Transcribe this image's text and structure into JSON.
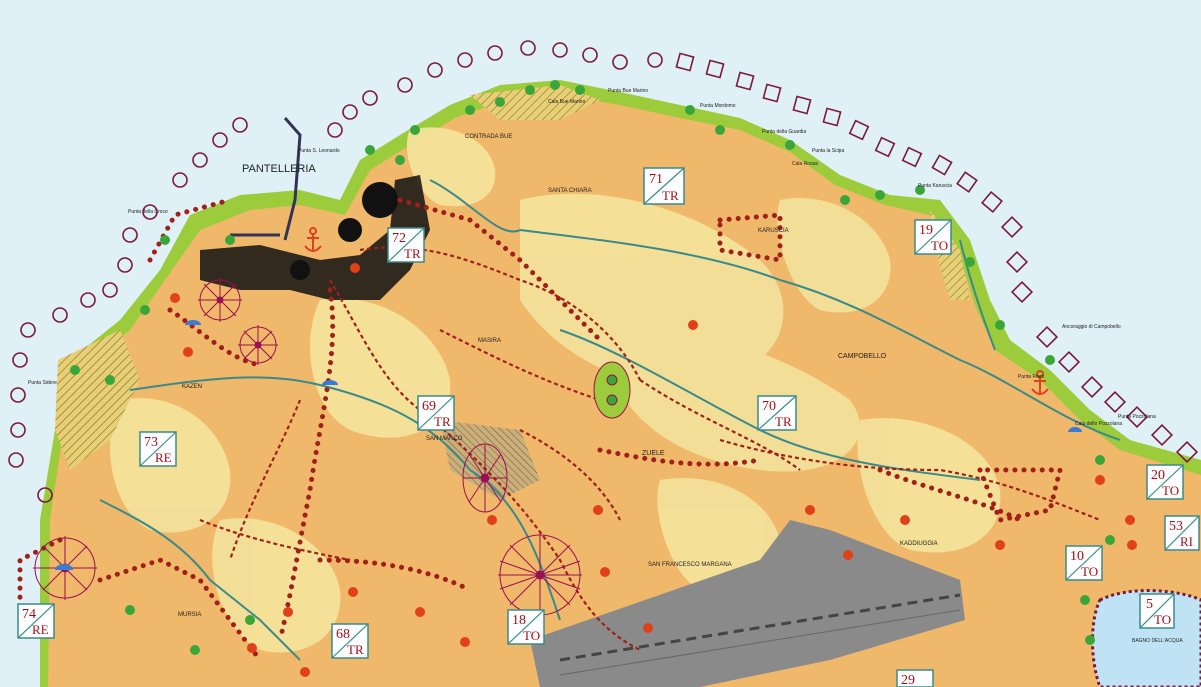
{
  "map": {
    "colors": {
      "sea": "#dff0f6",
      "land_light": "#f3e19a",
      "land_orange": "#f0b86a",
      "coast_green": "#9ccb3c",
      "road_red": "#a0201a",
      "route_teal": "#3a8a8a",
      "runway_gray": "#8a8a8a",
      "lake_blue": "#bfe3f5",
      "urban_black": "#111111",
      "buoy_circle": "#7a1a3a",
      "buoy_square": "#7a1a3a"
    },
    "place_labels": [
      {
        "id": "pantelleria",
        "text": "PANTELLERIA"
      },
      {
        "id": "punta-s-leonardo",
        "text": "Punta S. Leonardo"
      },
      {
        "id": "punta-della-croce",
        "text": "Punta della Croce"
      },
      {
        "id": "punta-bue-marino",
        "text": "Punta Bue Marino"
      },
      {
        "id": "cala-bue-marino",
        "text": "Cala Bue Marino"
      },
      {
        "id": "contrada-bue",
        "text": "CONTRADA BUE"
      },
      {
        "id": "punta-mordomo",
        "text": "Punta Mordomo"
      },
      {
        "id": "punta-della-guardia",
        "text": "Punta della Guardia"
      },
      {
        "id": "punta-la-scipa",
        "text": "Punta la Scipa"
      },
      {
        "id": "cala-rossa",
        "text": "Cala Rossa"
      },
      {
        "id": "punta-karuscia",
        "text": "Punta Karuscia"
      },
      {
        "id": "santa-chiara",
        "text": "SANTA CHIARA"
      },
      {
        "id": "karuscia",
        "text": "KARUSCIA"
      },
      {
        "id": "campobello",
        "text": "CAMPOBELLO"
      },
      {
        "id": "ancoraggio-campobello",
        "text": "Ancoraggio di Campobello"
      },
      {
        "id": "punta-fram",
        "text": "Punta Fram"
      },
      {
        "id": "punta-pozzolana",
        "text": "Punta Pozzolana"
      },
      {
        "id": "cala-dello-pozzolana",
        "text": "Cala dello Pozzolana"
      },
      {
        "id": "kazen",
        "text": "KAZEN"
      },
      {
        "id": "punta-sidere",
        "text": "Punta Sidere"
      },
      {
        "id": "san-marco",
        "text": "SAN MARCO"
      },
      {
        "id": "zuele",
        "text": "ZUELE"
      },
      {
        "id": "san-francesco-margana",
        "text": "SAN FRANCESCO MARGANA"
      },
      {
        "id": "kaddiuggia",
        "text": "KADDIUGGIA"
      },
      {
        "id": "mursia",
        "text": "MURSIA"
      },
      {
        "id": "bagno-dell-acqua",
        "text": "BAGNO DELL'ACQUA"
      },
      {
        "id": "masira",
        "text": "MASIRA"
      }
    ],
    "zones": [
      {
        "id": "71",
        "num": "71",
        "code": "TR"
      },
      {
        "id": "72",
        "num": "72",
        "code": "TR"
      },
      {
        "id": "19",
        "num": "19",
        "code": "TO"
      },
      {
        "id": "69",
        "num": "69",
        "code": "TR"
      },
      {
        "id": "70",
        "num": "70",
        "code": "TR"
      },
      {
        "id": "73",
        "num": "73",
        "code": "RE"
      },
      {
        "id": "20",
        "num": "20",
        "code": "TO"
      },
      {
        "id": "53",
        "num": "53",
        "code": "RI"
      },
      {
        "id": "10",
        "num": "10",
        "code": "TO"
      },
      {
        "id": "74",
        "num": "74",
        "code": "RE"
      },
      {
        "id": "18",
        "num": "18",
        "code": "TO"
      },
      {
        "id": "68",
        "num": "68",
        "code": "TR"
      },
      {
        "id": "5",
        "num": "5",
        "code": "TO"
      },
      {
        "id": "29",
        "num": "29",
        "code": ""
      }
    ],
    "icons": [
      {
        "id": "anchor-port",
        "name": "anchor-icon"
      },
      {
        "id": "anchor-campobello",
        "name": "anchor-icon"
      }
    ]
  }
}
